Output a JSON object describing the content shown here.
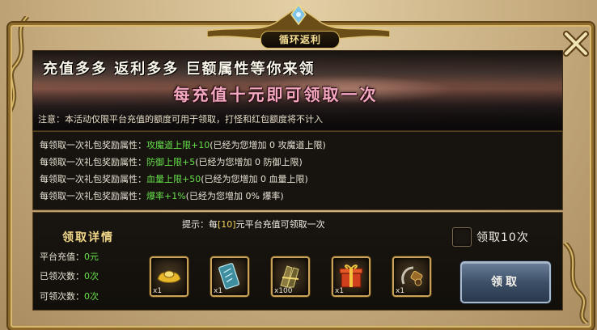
{
  "window": {
    "title": "循环返利"
  },
  "banner": {
    "headline": "充值多多  返利多多  巨额属性等你来领",
    "subline": "每充值十元即可领取一次",
    "note": "注意：本活动仅限平台充值的额度可用于领取，打怪和红包额度将不计入"
  },
  "rewards": [
    {
      "prefix": "每领取一次礼包奖励属性：",
      "bonus": "攻魔道上限+10",
      "suffix": "(已经为您增加 0 攻魔道上限)"
    },
    {
      "prefix": "每领取一次礼包奖励属性：",
      "bonus": "防御上限+5",
      "suffix": "(已经为您增加 0 防御上限)"
    },
    {
      "prefix": "每领取一次礼包奖励属性：",
      "bonus": "血量上限+50",
      "suffix": "(已经为您增加 0 血量上限)"
    },
    {
      "prefix": "每领取一次礼包奖励属性：",
      "bonus": "爆率+1%",
      "suffix": "(已经为您增加 0% 爆率)"
    }
  ],
  "details": {
    "title": "领取详情",
    "recharge_label": "平台充值：",
    "recharge_value": "0元",
    "claimed_label": "已领次数：",
    "claimed_value": "0次",
    "available_label": "可领次数：",
    "available_value": "0次"
  },
  "hint": {
    "before": "提示：每",
    "amount": "[10]",
    "after": "元平台充值可领取一次"
  },
  "claim_ten": {
    "label": "领取10次",
    "checked": false
  },
  "items": [
    {
      "icon": "gold-ingot-icon",
      "qty": "x1"
    },
    {
      "icon": "scroll-ticket-icon",
      "qty": "x1"
    },
    {
      "icon": "bundle-icon",
      "qty": "x100"
    },
    {
      "icon": "gift-box-icon",
      "qty": "x1"
    },
    {
      "icon": "hook-tool-icon",
      "qty": "x1"
    }
  ],
  "claim_button": {
    "label": "领取"
  }
}
